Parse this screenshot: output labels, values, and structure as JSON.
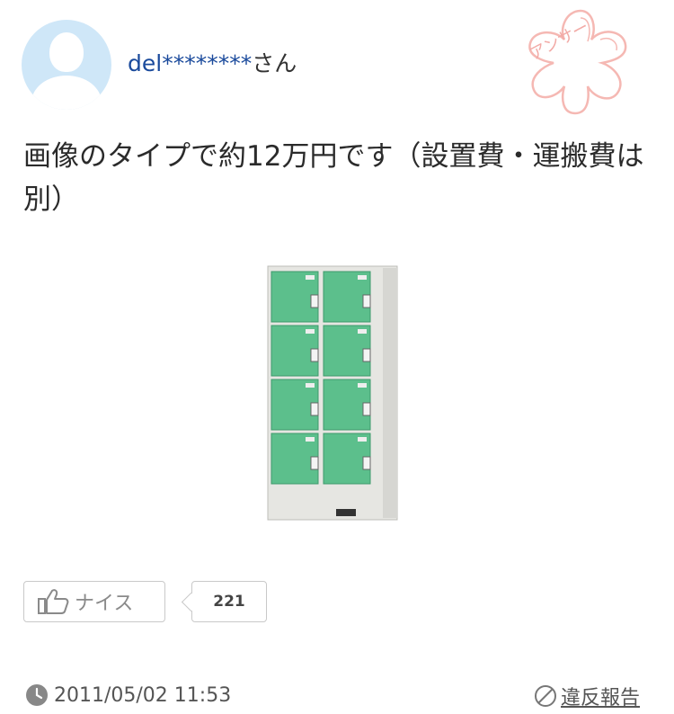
{
  "answer": {
    "username": "del********",
    "honorific": "さん",
    "body": "画像のタイプで約12万円です（設置費・運搬費は別）",
    "image_icon": "green-8-door-locker-photo",
    "like_label": "ナイス",
    "like_count": "221",
    "timestamp": "2011/05/02 11:53",
    "report_label": "違反報告"
  },
  "stamp": {
    "text": "アンサー",
    "color": "#f2aaa6"
  },
  "colors": {
    "username": "#1a4a9c",
    "locker_door": "#5cbf8c",
    "avatar_bg": "#cfe7f8"
  }
}
